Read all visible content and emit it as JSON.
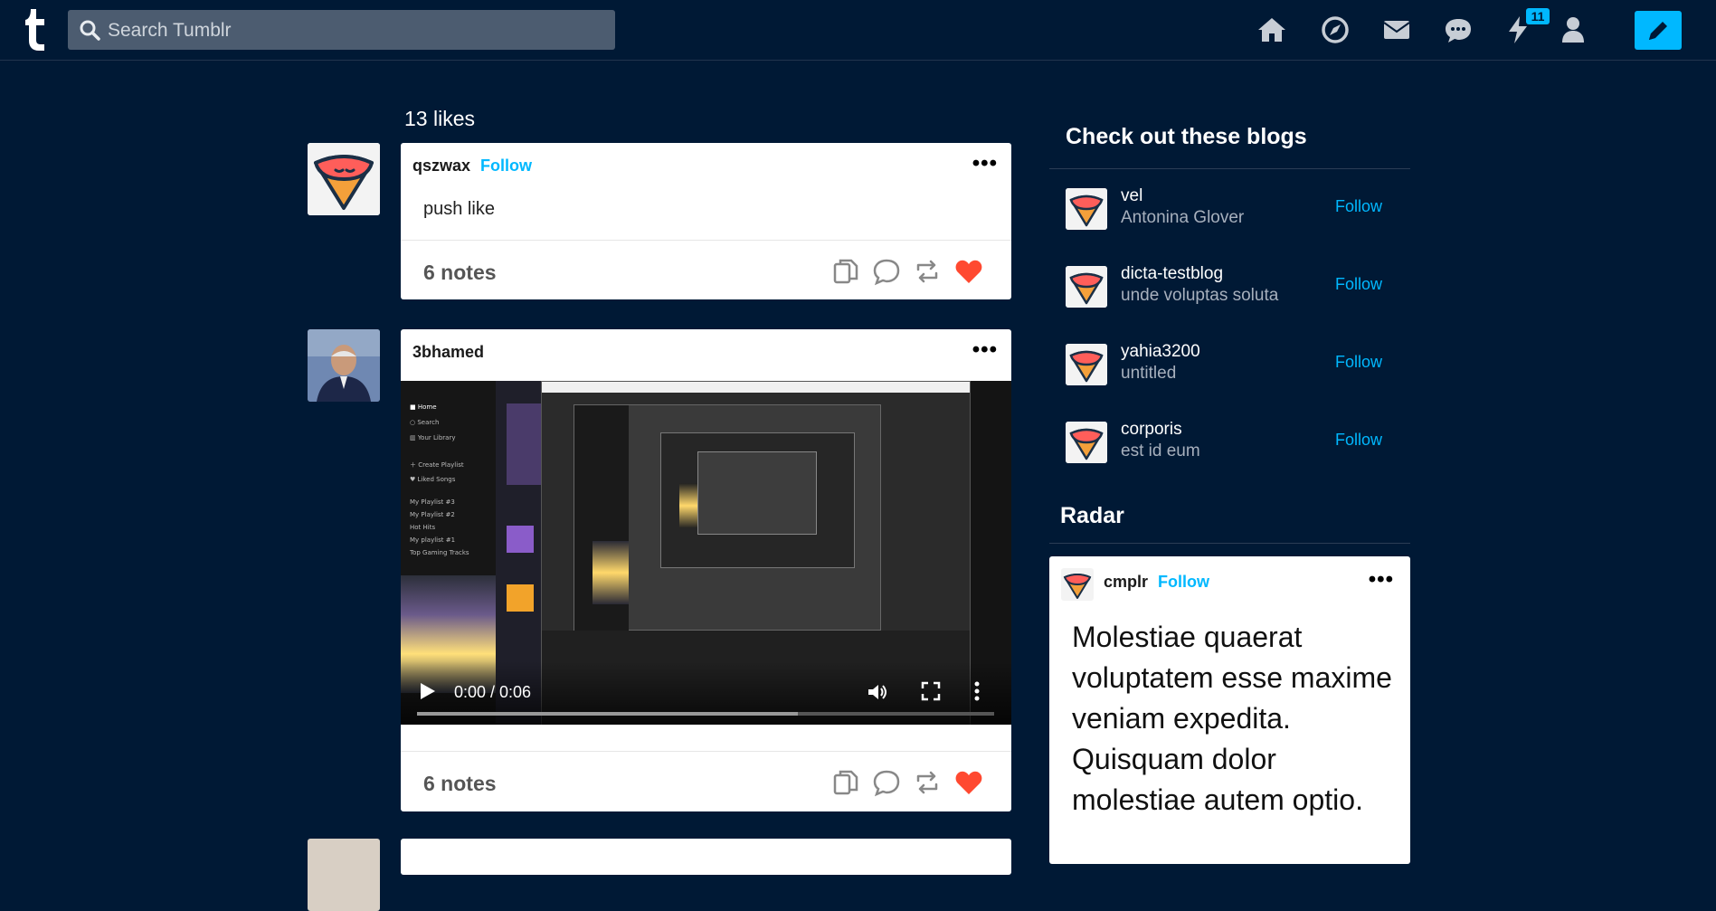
{
  "header": {
    "logo": "t",
    "search_placeholder": "Search Tumblr",
    "icons": [
      "home-icon",
      "explore-icon",
      "inbox-icon",
      "messages-icon",
      "activity-icon",
      "account-icon"
    ],
    "activity_badge": "11",
    "compose_icon": "pencil-icon"
  },
  "main": {
    "likes_label": "13 likes",
    "posts": [
      {
        "blog": "qszwax",
        "follow": "Follow",
        "text": "push like",
        "notes": "6 notes"
      },
      {
        "blog": "3bhamed",
        "video_time": "0:00 / 0:06",
        "video_progress": 0,
        "video_buffered": 0.66,
        "notes": "6 notes"
      }
    ]
  },
  "sidebar": {
    "check_out_title": "Check out these blogs",
    "blogs": [
      {
        "name": "vel",
        "title": "Antonina Glover",
        "follow": "Follow"
      },
      {
        "name": "dicta-testblog",
        "title": "unde voluptas soluta",
        "follow": "Follow"
      },
      {
        "name": "yahia3200",
        "title": "untitled",
        "follow": "Follow"
      },
      {
        "name": "corporis",
        "title": "est id eum",
        "follow": "Follow"
      }
    ],
    "radar_title": "Radar",
    "radar_post": {
      "blog": "cmplr",
      "follow": "Follow",
      "text": "Molestiae quaerat voluptatem esse maxime veniam expedita. Quisquam dolor molestiae autem optio."
    }
  },
  "colors": {
    "background": "#001935",
    "accent": "#00b8ff",
    "like": "#ff4930"
  }
}
